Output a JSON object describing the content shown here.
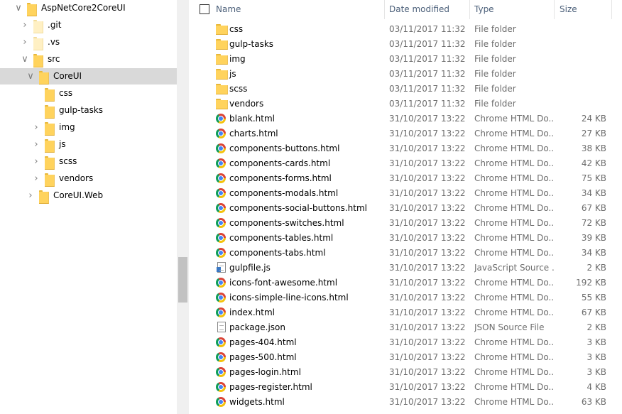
{
  "tree": [
    {
      "label": "AspNetCore2CoreUI",
      "depth": 0,
      "chevron": "expanded",
      "pale": false,
      "selected": false,
      "icon": "folder-icon"
    },
    {
      "label": ".git",
      "depth": 1,
      "chevron": "collapsed",
      "pale": true,
      "selected": false,
      "icon": "folder-icon"
    },
    {
      "label": ".vs",
      "depth": 1,
      "chevron": "collapsed",
      "pale": true,
      "selected": false,
      "icon": "folder-icon"
    },
    {
      "label": "src",
      "depth": 1,
      "chevron": "expanded",
      "pale": false,
      "selected": false,
      "icon": "folder-icon"
    },
    {
      "label": "CoreUI",
      "depth": 2,
      "chevron": "expanded",
      "pale": false,
      "selected": true,
      "icon": "folder-icon"
    },
    {
      "label": "css",
      "depth": 3,
      "chevron": "none",
      "pale": false,
      "selected": false,
      "icon": "folder-icon"
    },
    {
      "label": "gulp-tasks",
      "depth": 3,
      "chevron": "none",
      "pale": false,
      "selected": false,
      "icon": "folder-icon"
    },
    {
      "label": "img",
      "depth": 3,
      "chevron": "collapsed",
      "pale": false,
      "selected": false,
      "icon": "folder-icon"
    },
    {
      "label": "js",
      "depth": 3,
      "chevron": "collapsed",
      "pale": false,
      "selected": false,
      "icon": "folder-icon"
    },
    {
      "label": "scss",
      "depth": 3,
      "chevron": "collapsed",
      "pale": false,
      "selected": false,
      "icon": "folder-icon"
    },
    {
      "label": "vendors",
      "depth": 3,
      "chevron": "collapsed",
      "pale": false,
      "selected": false,
      "icon": "folder-icon"
    },
    {
      "label": "CoreUI.Web",
      "depth": 2,
      "chevron": "collapsed",
      "pale": false,
      "selected": false,
      "icon": "folder-icon"
    }
  ],
  "columns": {
    "name": "Name",
    "date": "Date modified",
    "type": "Type",
    "size": "Size"
  },
  "files": [
    {
      "name": "css",
      "date": "03/11/2017 11:32",
      "type": "File folder",
      "size": "",
      "icon": "folder-icon"
    },
    {
      "name": "gulp-tasks",
      "date": "03/11/2017 11:32",
      "type": "File folder",
      "size": "",
      "icon": "folder-icon"
    },
    {
      "name": "img",
      "date": "03/11/2017 11:32",
      "type": "File folder",
      "size": "",
      "icon": "folder-icon"
    },
    {
      "name": "js",
      "date": "03/11/2017 11:32",
      "type": "File folder",
      "size": "",
      "icon": "folder-icon"
    },
    {
      "name": "scss",
      "date": "03/11/2017 11:32",
      "type": "File folder",
      "size": "",
      "icon": "folder-icon"
    },
    {
      "name": "vendors",
      "date": "03/11/2017 11:32",
      "type": "File folder",
      "size": "",
      "icon": "folder-icon"
    },
    {
      "name": "blank.html",
      "date": "31/10/2017 13:22",
      "type": "Chrome HTML Do...",
      "size": "24 KB",
      "icon": "chrome-icon"
    },
    {
      "name": "charts.html",
      "date": "31/10/2017 13:22",
      "type": "Chrome HTML Do...",
      "size": "27 KB",
      "icon": "chrome-icon"
    },
    {
      "name": "components-buttons.html",
      "date": "31/10/2017 13:22",
      "type": "Chrome HTML Do...",
      "size": "38 KB",
      "icon": "chrome-icon"
    },
    {
      "name": "components-cards.html",
      "date": "31/10/2017 13:22",
      "type": "Chrome HTML Do...",
      "size": "42 KB",
      "icon": "chrome-icon"
    },
    {
      "name": "components-forms.html",
      "date": "31/10/2017 13:22",
      "type": "Chrome HTML Do...",
      "size": "75 KB",
      "icon": "chrome-icon"
    },
    {
      "name": "components-modals.html",
      "date": "31/10/2017 13:22",
      "type": "Chrome HTML Do...",
      "size": "34 KB",
      "icon": "chrome-icon"
    },
    {
      "name": "components-social-buttons.html",
      "date": "31/10/2017 13:22",
      "type": "Chrome HTML Do...",
      "size": "67 KB",
      "icon": "chrome-icon"
    },
    {
      "name": "components-switches.html",
      "date": "31/10/2017 13:22",
      "type": "Chrome HTML Do...",
      "size": "72 KB",
      "icon": "chrome-icon"
    },
    {
      "name": "components-tables.html",
      "date": "31/10/2017 13:22",
      "type": "Chrome HTML Do...",
      "size": "39 KB",
      "icon": "chrome-icon"
    },
    {
      "name": "components-tabs.html",
      "date": "31/10/2017 13:22",
      "type": "Chrome HTML Do...",
      "size": "34 KB",
      "icon": "chrome-icon"
    },
    {
      "name": "gulpfile.js",
      "date": "31/10/2017 13:22",
      "type": "JavaScript Source ...",
      "size": "2 KB",
      "icon": "js-file-icon"
    },
    {
      "name": "icons-font-awesome.html",
      "date": "31/10/2017 13:22",
      "type": "Chrome HTML Do...",
      "size": "192 KB",
      "icon": "chrome-icon"
    },
    {
      "name": "icons-simple-line-icons.html",
      "date": "31/10/2017 13:22",
      "type": "Chrome HTML Do...",
      "size": "55 KB",
      "icon": "chrome-icon"
    },
    {
      "name": "index.html",
      "date": "31/10/2017 13:22",
      "type": "Chrome HTML Do...",
      "size": "67 KB",
      "icon": "chrome-icon"
    },
    {
      "name": "package.json",
      "date": "31/10/2017 13:22",
      "type": "JSON Source File",
      "size": "2 KB",
      "icon": "json-file-icon"
    },
    {
      "name": "pages-404.html",
      "date": "31/10/2017 13:22",
      "type": "Chrome HTML Do...",
      "size": "3 KB",
      "icon": "chrome-icon"
    },
    {
      "name": "pages-500.html",
      "date": "31/10/2017 13:22",
      "type": "Chrome HTML Do...",
      "size": "3 KB",
      "icon": "chrome-icon"
    },
    {
      "name": "pages-login.html",
      "date": "31/10/2017 13:22",
      "type": "Chrome HTML Do...",
      "size": "3 KB",
      "icon": "chrome-icon"
    },
    {
      "name": "pages-register.html",
      "date": "31/10/2017 13:22",
      "type": "Chrome HTML Do...",
      "size": "4 KB",
      "icon": "chrome-icon"
    },
    {
      "name": "widgets.html",
      "date": "31/10/2017 13:22",
      "type": "Chrome HTML Do...",
      "size": "63 KB",
      "icon": "chrome-icon"
    }
  ]
}
